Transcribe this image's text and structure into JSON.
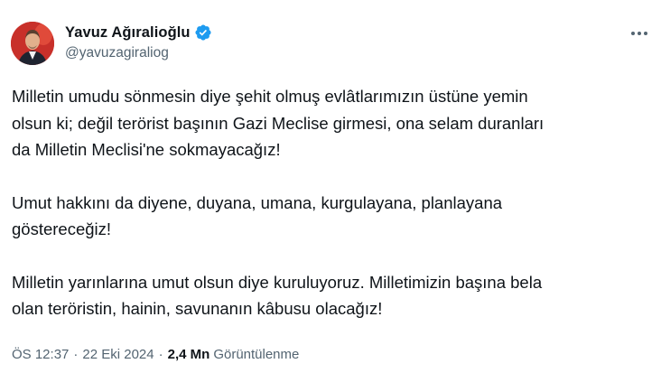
{
  "author": {
    "name": "Yavuz Ağıralioğlu",
    "handle": "@yavuzagiraliog",
    "verified": true,
    "verified_color": "#1d9bf0",
    "avatar_bg": "#c8302a"
  },
  "menu_icon": "more-horizontal-icon",
  "tweet": {
    "paragraphs": [
      [
        "Milletin umudu sönmesin diye şehit olmuş evlâtlarımızın üstüne yemin",
        "olsun ki; değil terörist başının Gazi Meclise girmesi, ona selam duranları",
        "da Milletin Meclisi'ne sokmayacağız!"
      ],
      [
        "Umut hakkını da diyene, duyana, umana, kurgulayana, planlayana",
        "göstereceğiz!"
      ],
      [
        "Milletin yarınlarına umut olsun diye kuruluyoruz. Milletimizin başına bela",
        "olan teröristin, hainin, savunanın kâbusu olacağız!"
      ]
    ]
  },
  "meta": {
    "time": "ÖS 12:37",
    "separator": "·",
    "date": "22 Eki 2024",
    "views_count": "2,4 Mn",
    "views_label": "Görüntülenme"
  }
}
